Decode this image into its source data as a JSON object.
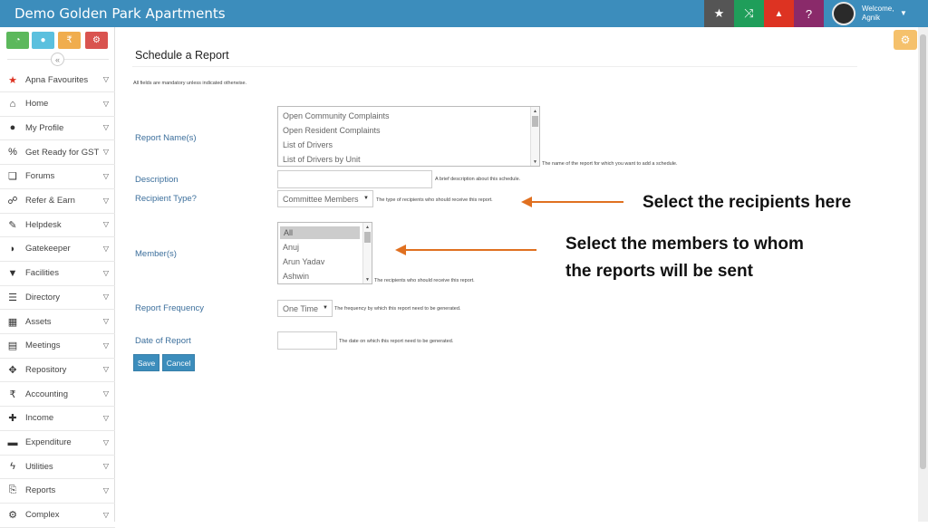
{
  "header": {
    "title": "Demo Golden Park Apartments",
    "buttons": [
      {
        "icon": "star-icon",
        "glyph": "★",
        "color": "#555555"
      },
      {
        "icon": "shuffle-icon",
        "glyph": "⤨",
        "color": "#1f9e5a"
      },
      {
        "icon": "bell-icon",
        "glyph": "🔔",
        "color": "#dd3322"
      },
      {
        "icon": "help-icon",
        "glyph": "?",
        "color": "#8a2a6a"
      }
    ],
    "welcome": "Welcome,",
    "user": "Agnik"
  },
  "sidebar": {
    "quick_actions": [
      {
        "icon": "dashboard-icon",
        "glyph": "◔",
        "color": "#5cb85c"
      },
      {
        "icon": "chat-icon",
        "glyph": "●",
        "color": "#5bc0de"
      },
      {
        "icon": "rupee-icon",
        "glyph": "₹",
        "color": "#f0ad4e"
      },
      {
        "icon": "settings-icon",
        "glyph": "⚙",
        "color": "#d9534f"
      }
    ],
    "collapse_glyph": "«",
    "items": [
      {
        "label": "Apna Favourites",
        "icon": "star-icon",
        "glyph": "★",
        "color": "#dd3322"
      },
      {
        "label": "Home",
        "icon": "home-icon",
        "glyph": "⌂",
        "color": "#333333"
      },
      {
        "label": "My Profile",
        "icon": "user-icon",
        "glyph": "●",
        "color": "#333333"
      },
      {
        "label": "Get Ready for GST",
        "icon": "percent-icon",
        "glyph": "%",
        "color": "#333333"
      },
      {
        "label": "Forums",
        "icon": "comments-icon",
        "glyph": "❏",
        "color": "#333333"
      },
      {
        "label": "Refer & Earn",
        "icon": "handshake-icon",
        "glyph": "☍",
        "color": "#333333"
      },
      {
        "label": "Helpdesk",
        "icon": "wrench-icon",
        "glyph": "✎",
        "color": "#333333"
      },
      {
        "label": "Gatekeeper",
        "icon": "shield-icon",
        "glyph": "◗",
        "color": "#333333"
      },
      {
        "label": "Facilities",
        "icon": "filter-icon",
        "glyph": "▼",
        "color": "#333333"
      },
      {
        "label": "Directory",
        "icon": "list-icon",
        "glyph": "☰",
        "color": "#333333"
      },
      {
        "label": "Assets",
        "icon": "building-icon",
        "glyph": "▦",
        "color": "#333333"
      },
      {
        "label": "Meetings",
        "icon": "calendar-icon",
        "glyph": "▤",
        "color": "#333333"
      },
      {
        "label": "Repository",
        "icon": "dropbox-icon",
        "glyph": "✥",
        "color": "#333333"
      },
      {
        "label": "Accounting",
        "icon": "rupee-icon",
        "glyph": "₹",
        "color": "#333333"
      },
      {
        "label": "Income",
        "icon": "plus-icon",
        "glyph": "✚",
        "color": "#333333"
      },
      {
        "label": "Expenditure",
        "icon": "minus-icon",
        "glyph": "▬",
        "color": "#333333"
      },
      {
        "label": "Utilities",
        "icon": "bolt-icon",
        "glyph": "ϟ",
        "color": "#333333"
      },
      {
        "label": "Reports",
        "icon": "reports-icon",
        "glyph": "⎘",
        "color": "#333333"
      },
      {
        "label": "Complex",
        "icon": "cog-icon",
        "glyph": "⚙",
        "color": "#333333"
      }
    ]
  },
  "main": {
    "title": "Schedule a Report",
    "mandatory_note": "All fields are mandatory unless indicated otherwise.",
    "report_names": {
      "label": "Report Name(s)",
      "options": [
        "Open Community Complaints",
        "Open Resident Complaints",
        "List of Drivers",
        "List of Drivers by Unit"
      ],
      "hint": "The name of the report for which you want to add a schedule."
    },
    "description": {
      "label": "Description",
      "value": "",
      "hint": "A brief description about this schedule."
    },
    "recipient_type": {
      "label": "Recipient Type?",
      "value": "Committee Members",
      "hint": "The type of recipients who should receive this report."
    },
    "members": {
      "label": "Member(s)",
      "options": [
        "All",
        "Anuj",
        "Arun Yadav",
        "Ashwin"
      ],
      "selected": "All",
      "hint": "The recipients who should receive this report."
    },
    "frequency": {
      "label": "Report Frequency",
      "value": "One Time",
      "hint": "The frequency by which this report need to be generated."
    },
    "date": {
      "label": "Date of Report",
      "value": "",
      "hint": "The date on which this report need to be generated."
    },
    "save_label": "Save",
    "cancel_label": "Cancel"
  },
  "annotations": {
    "recipients": "Select the recipients here",
    "members_line1": "Select the members to whom",
    "members_line2": "the reports will be sent",
    "arrow_color": "#e07020"
  }
}
